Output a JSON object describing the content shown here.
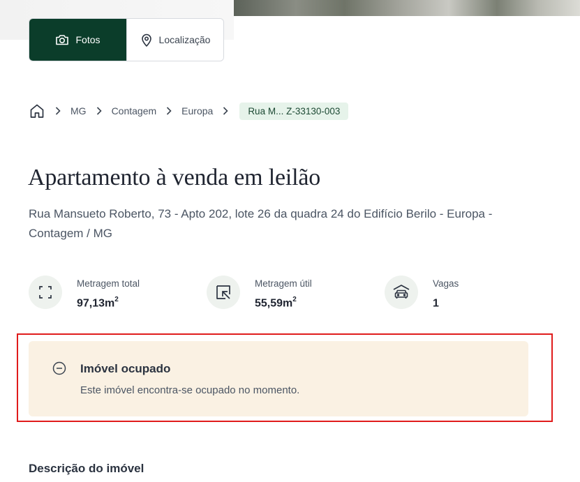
{
  "media_tabs": [
    {
      "label": "Fotos",
      "icon": "camera-icon",
      "active": true
    },
    {
      "label": "Localização",
      "icon": "location-pin-icon",
      "active": false
    }
  ],
  "breadcrumb": {
    "home_icon": "home-icon",
    "items": [
      "MG",
      "Contagem",
      "Europa"
    ],
    "current": "Rua M... Z-33130-003"
  },
  "listing": {
    "title": "Apartamento à venda em leilão",
    "address": "Rua Mansueto Roberto, 73 - Apto 202, lote 26 da quadra 24 do Edifício Berilo - Europa - Contagem / MG"
  },
  "stats": [
    {
      "label": "Metragem total",
      "value": "97,13m",
      "unit_sup": "2",
      "icon": "expand-icon"
    },
    {
      "label": "Metragem útil",
      "value": "55,59m",
      "unit_sup": "2",
      "icon": "arrow-inward-icon"
    },
    {
      "label": "Vagas",
      "value": "1",
      "unit_sup": "",
      "icon": "garage-car-icon"
    }
  ],
  "notice": {
    "title": "Imóvel ocupado",
    "text": "Este imóvel encontra-se ocupado no momento.",
    "icon": "minus-circle-icon"
  },
  "description": {
    "title": "Descrição do imóvel"
  },
  "colors": {
    "brand_green": "#0b3d2a",
    "breadcrumb_badge_bg": "#e6f3ea",
    "notice_bg": "#faf1e3",
    "highlight_red": "#e01b1b"
  }
}
